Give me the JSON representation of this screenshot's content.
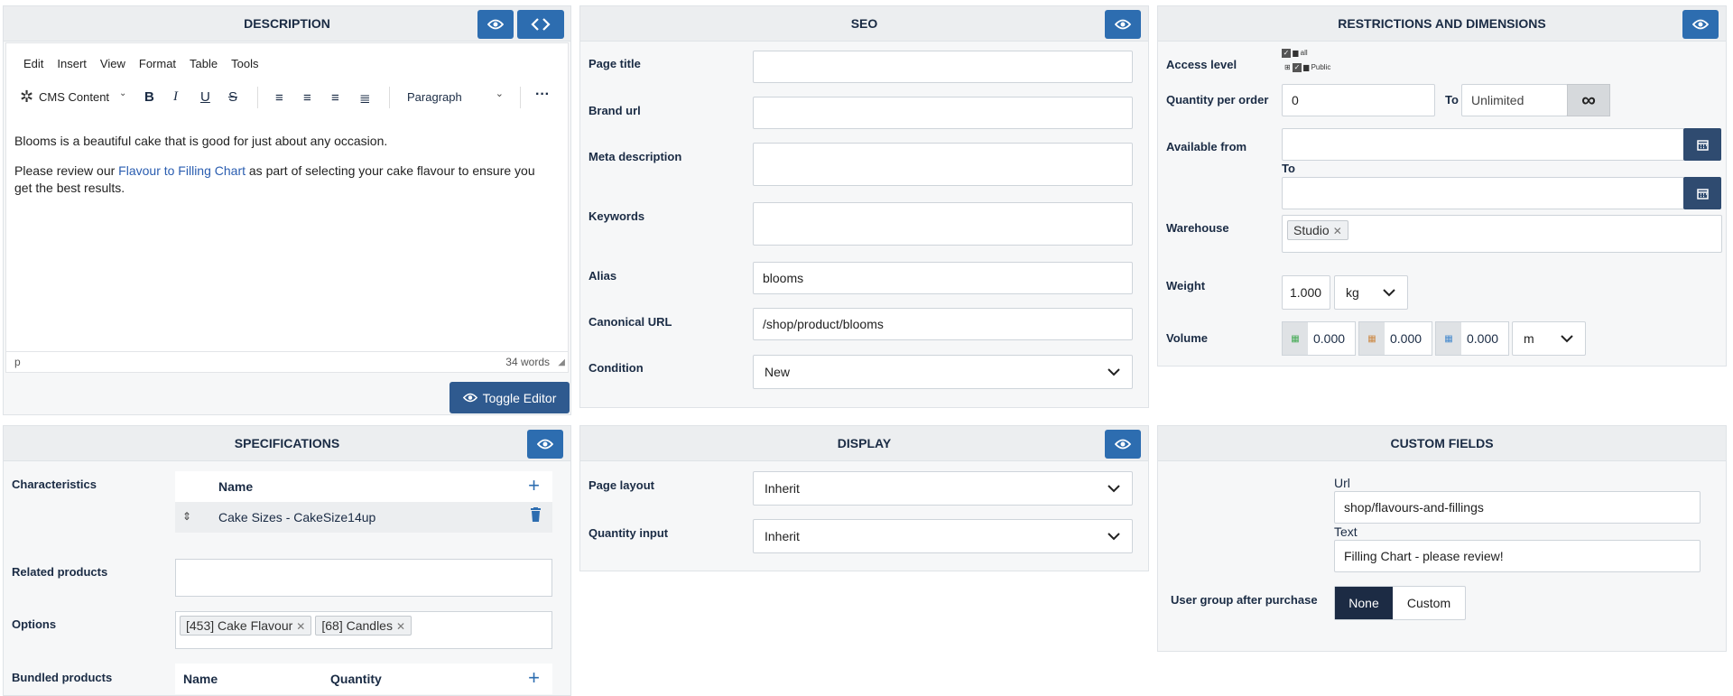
{
  "description": {
    "title": "DESCRIPTION",
    "menu": [
      "Edit",
      "Insert",
      "View",
      "Format",
      "Table",
      "Tools"
    ],
    "cms_content": "CMS Content",
    "paragraph_select": "Paragraph",
    "text_line1": "Blooms is a beautiful cake that is good for just about any occasion.",
    "text_line2_before": "Please review our ",
    "text_link": "Flavour to Filling Chart",
    "text_line2_after": " as part of selecting your cake flavour to ensure you",
    "text_line3": "get the best results.",
    "status_path": "p",
    "word_count": "34 words",
    "toggle_editor": "Toggle Editor"
  },
  "seo": {
    "title": "SEO",
    "page_title_label": "Page title",
    "page_title_value": "",
    "brand_url_label": "Brand url",
    "brand_url_value": "",
    "meta_description_label": "Meta description",
    "keywords_label": "Keywords",
    "alias_label": "Alias",
    "alias_value": "blooms",
    "canonical_label": "Canonical URL",
    "canonical_value": "/shop/product/blooms",
    "condition_label": "Condition",
    "condition_value": "New"
  },
  "restrictions": {
    "title": "RESTRICTIONS AND DIMENSIONS",
    "access_level_label": "Access level",
    "access_all": "all",
    "access_public": "Public",
    "qty_label": "Quantity per order",
    "qty_from": "0",
    "qty_to_label": "To",
    "qty_to": "Unlimited",
    "available_from_label": "Available from",
    "available_to_label": "To",
    "warehouse_label": "Warehouse",
    "warehouse_tag": "Studio",
    "weight_label": "Weight",
    "weight_value": "1.000",
    "weight_unit": "kg",
    "volume_label": "Volume",
    "volume_values": [
      "0.000",
      "0.000",
      "0.000"
    ],
    "volume_unit": "m"
  },
  "specifications": {
    "title": "SPECIFICATIONS",
    "characteristics_label": "Characteristics",
    "name_header": "Name",
    "char_row": "Cake Sizes - CakeSize14up",
    "related_label": "Related products",
    "options_label": "Options",
    "option_tags": [
      "[453] Cake Flavour",
      "[68] Candles"
    ],
    "bundled_label": "Bundled products",
    "bundled_name_header": "Name",
    "bundled_qty_header": "Quantity"
  },
  "display": {
    "title": "DISPLAY",
    "page_layout_label": "Page layout",
    "page_layout_value": "Inherit",
    "qty_input_label": "Quantity input",
    "qty_input_value": "Inherit"
  },
  "custom_fields": {
    "title": "CUSTOM FIELDS",
    "url_label": "Url",
    "url_value": "shop/flavours-and-fillings",
    "text_label": "Text",
    "text_value": "Filling Chart - please review!",
    "user_group_label": "User group after purchase",
    "none_label": "None",
    "custom_label": "Custom"
  },
  "colors": {
    "accent": "#2d6db0",
    "dark": "#1a2b44",
    "link": "#2a5db0"
  }
}
